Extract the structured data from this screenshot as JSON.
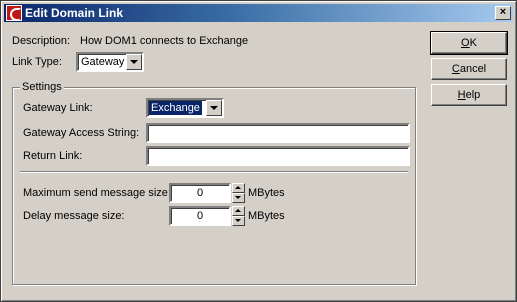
{
  "window": {
    "title": "Edit Domain Link",
    "close_glyph": "×"
  },
  "description": {
    "label": "Description:",
    "value": "How DOM1 connects to Exchange"
  },
  "link_type": {
    "label": "Link Type:",
    "value": "Gateway"
  },
  "settings": {
    "group_title": "Settings",
    "gateway_link": {
      "label": "Gateway Link:",
      "value": "Exchange"
    },
    "gateway_access_string": {
      "label": "Gateway Access String:",
      "value": ""
    },
    "return_link": {
      "label": "Return Link:",
      "value": ""
    },
    "max_send_size": {
      "label": "Maximum send message size:",
      "value": "0",
      "unit": "MBytes"
    },
    "delay_size": {
      "label": "Delay message size:",
      "value": "0",
      "unit": "MBytes"
    }
  },
  "buttons": {
    "ok": {
      "mnemonic": "O",
      "rest": "K"
    },
    "cancel": {
      "mnemonic": "C",
      "rest": "ancel"
    },
    "help": {
      "mnemonic": "H",
      "rest": "elp"
    }
  },
  "icons": {
    "app": "groupwise-app-icon",
    "close": "close-icon"
  }
}
